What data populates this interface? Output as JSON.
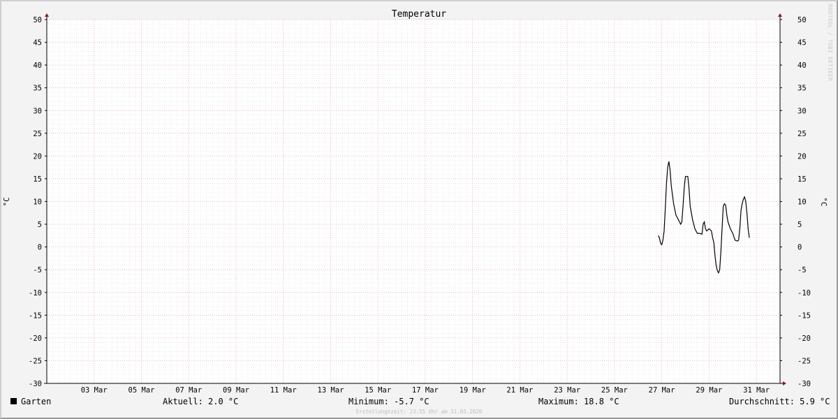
{
  "chart_data": {
    "type": "line",
    "title": "Temperatur",
    "ylabel_left": "°C",
    "ylabel_right": "°C",
    "ylim": [
      -30,
      50
    ],
    "y_ticks": [
      50,
      45,
      40,
      35,
      30,
      25,
      20,
      15,
      10,
      5,
      0,
      -5,
      -10,
      -15,
      -20,
      -25,
      -30
    ],
    "x_range_days": [
      1,
      32
    ],
    "x_tick_days": [
      3,
      5,
      7,
      9,
      11,
      13,
      15,
      17,
      19,
      21,
      23,
      25,
      27,
      29,
      31
    ],
    "x_tick_labels": [
      "03 Mar",
      "05 Mar",
      "07 Mar",
      "09 Mar",
      "11 Mar",
      "13 Mar",
      "15 Mar",
      "17 Mar",
      "19 Mar",
      "21 Mar",
      "23 Mar",
      "25 Mar",
      "27 Mar",
      "29 Mar",
      "31 Mar"
    ],
    "grid": true,
    "legend_position": "bottom",
    "series": [
      {
        "name": "Garten",
        "color": "#000000",
        "points": [
          [
            26.85,
            2.5
          ],
          [
            26.9,
            2.0
          ],
          [
            26.95,
            0.8
          ],
          [
            27.0,
            0.5
          ],
          [
            27.05,
            1.5
          ],
          [
            27.1,
            3.5
          ],
          [
            27.15,
            8.5
          ],
          [
            27.2,
            14.0
          ],
          [
            27.25,
            17.5
          ],
          [
            27.3,
            18.8
          ],
          [
            27.35,
            17.0
          ],
          [
            27.4,
            13.5
          ],
          [
            27.45,
            11.5
          ],
          [
            27.5,
            9.5
          ],
          [
            27.6,
            7.0
          ],
          [
            27.7,
            6.0
          ],
          [
            27.8,
            5.0
          ],
          [
            27.85,
            5.5
          ],
          [
            27.9,
            9.0
          ],
          [
            27.95,
            13.0
          ],
          [
            28.0,
            15.5
          ],
          [
            28.1,
            15.5
          ],
          [
            28.15,
            13.0
          ],
          [
            28.2,
            9.0
          ],
          [
            28.3,
            6.0
          ],
          [
            28.4,
            4.0
          ],
          [
            28.5,
            3.0
          ],
          [
            28.6,
            3.0
          ],
          [
            28.7,
            2.8
          ],
          [
            28.75,
            5.0
          ],
          [
            28.8,
            5.5
          ],
          [
            28.85,
            4.0
          ],
          [
            28.9,
            3.5
          ],
          [
            29.0,
            4.0
          ],
          [
            29.1,
            3.5
          ],
          [
            29.15,
            2.0
          ],
          [
            29.2,
            1.0
          ],
          [
            29.25,
            -2.0
          ],
          [
            29.3,
            -4.0
          ],
          [
            29.35,
            -5.2
          ],
          [
            29.4,
            -5.7
          ],
          [
            29.45,
            -5.0
          ],
          [
            29.5,
            -1.0
          ],
          [
            29.55,
            4.0
          ],
          [
            29.6,
            9.0
          ],
          [
            29.65,
            9.5
          ],
          [
            29.7,
            9.2
          ],
          [
            29.75,
            7.0
          ],
          [
            29.8,
            5.5
          ],
          [
            29.9,
            4.0
          ],
          [
            30.0,
            3.0
          ],
          [
            30.1,
            1.5
          ],
          [
            30.2,
            1.3
          ],
          [
            30.25,
            1.5
          ],
          [
            30.3,
            4.0
          ],
          [
            30.35,
            8.0
          ],
          [
            30.4,
            9.5
          ],
          [
            30.45,
            10.5
          ],
          [
            30.5,
            11.0
          ],
          [
            30.55,
            10.0
          ],
          [
            30.6,
            7.5
          ],
          [
            30.65,
            4.0
          ],
          [
            30.7,
            2.0
          ]
        ]
      }
    ]
  },
  "watermark": "RRDTOOL / TOBI OETIKER",
  "legend": {
    "series_name": "Garten",
    "aktuell": "Aktuell: 2.0 °C",
    "minimum": "Minimum: -5.7 °C",
    "maximum": "Maximum: 18.8 °C",
    "durchschnitt": "Durchschnitt: 5.9 °C"
  },
  "footer": "Erstellungszeit: 23:55 Uhr am 31.03.2020",
  "colors": {
    "plot_bg": "#ffffff",
    "grid_minor": "#dcdcdc",
    "grid_major": "#e7a8a8",
    "axis": "#000000",
    "arrow": "#8b1a1a",
    "line": "#000000"
  }
}
